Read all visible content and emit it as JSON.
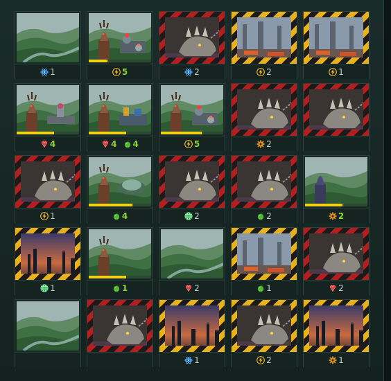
{
  "colors": {
    "hazard_red": "#b31f1f",
    "hazard_yellow": "#e8b21e",
    "value_highlight": "#8fd33a",
    "value_standard": "#c6d2cf"
  },
  "tiles": [
    {
      "art": "landscape",
      "border": "none",
      "progress": null,
      "resources": [
        {
          "icon": "atom-icon",
          "value": "1",
          "hi": false
        }
      ]
    },
    {
      "art": "alien-station",
      "border": "none",
      "progress": 0.3,
      "resources": [
        {
          "icon": "energy-icon",
          "value": "5",
          "hi": true
        }
      ]
    },
    {
      "art": "beast",
      "border": "red",
      "progress": null,
      "resources": [
        {
          "icon": "atom-icon",
          "value": "2",
          "hi": false
        }
      ]
    },
    {
      "art": "ruined-city",
      "border": "yellow",
      "progress": null,
      "resources": [
        {
          "icon": "energy-icon",
          "value": "2",
          "hi": false
        }
      ]
    },
    {
      "art": "ruined-city",
      "border": "yellow",
      "progress": null,
      "resources": [
        {
          "icon": "energy-icon",
          "value": "1",
          "hi": false
        }
      ]
    },
    {
      "art": "alien-lab",
      "border": "none",
      "progress": 0.6,
      "resources": [
        {
          "icon": "gem-icon",
          "value": "4",
          "hi": true
        }
      ]
    },
    {
      "art": "alien-factory",
      "border": "none",
      "progress": 0.6,
      "resources": [
        {
          "icon": "gem-icon",
          "value": "4",
          "hi": true
        },
        {
          "icon": "food-icon",
          "value": "4",
          "hi": true
        }
      ]
    },
    {
      "art": "alien-station",
      "border": "none",
      "progress": 0.65,
      "resources": [
        {
          "icon": "energy-icon",
          "value": "5",
          "hi": true
        }
      ]
    },
    {
      "art": "beast",
      "border": "red",
      "progress": null,
      "resources": [
        {
          "icon": "gear-icon",
          "value": "2",
          "hi": false
        }
      ]
    },
    {
      "art": "beast",
      "border": "red",
      "progress": null,
      "resources": []
    },
    {
      "art": "beast",
      "border": "red",
      "progress": null,
      "resources": [
        {
          "icon": "energy-icon",
          "value": "1",
          "hi": false
        }
      ]
    },
    {
      "art": "alien-dome",
      "border": "none",
      "progress": 0.7,
      "resources": [
        {
          "icon": "food-icon",
          "value": "4",
          "hi": true
        }
      ]
    },
    {
      "art": "beast",
      "border": "red",
      "progress": null,
      "resources": [
        {
          "icon": "globe-icon",
          "value": "2",
          "hi": false
        }
      ]
    },
    {
      "art": "beast",
      "border": "red",
      "progress": null,
      "resources": [
        {
          "icon": "food-icon",
          "value": "2",
          "hi": false
        }
      ]
    },
    {
      "art": "alien-lookout",
      "border": "none",
      "progress": 0.6,
      "resources": [
        {
          "icon": "gear-icon",
          "value": "2",
          "hi": true
        }
      ]
    },
    {
      "art": "sunset-city",
      "border": "yellow",
      "progress": null,
      "resources": [
        {
          "icon": "globe-icon",
          "value": "1",
          "hi": false
        }
      ]
    },
    {
      "art": "alien-valley",
      "border": "none",
      "progress": 0.6,
      "resources": [
        {
          "icon": "food-icon",
          "value": "1",
          "hi": true
        }
      ]
    },
    {
      "art": "landscape",
      "border": "none",
      "progress": null,
      "resources": [
        {
          "icon": "gem-icon",
          "value": "2",
          "hi": false
        }
      ]
    },
    {
      "art": "ruined-city",
      "border": "yellow",
      "progress": null,
      "resources": [
        {
          "icon": "food-icon",
          "value": "1",
          "hi": false
        }
      ]
    },
    {
      "art": "beast",
      "border": "red",
      "progress": null,
      "resources": [
        {
          "icon": "gem-icon",
          "value": "2",
          "hi": false
        }
      ]
    },
    {
      "art": "landscape",
      "border": "none",
      "progress": null,
      "resources": []
    },
    {
      "art": "beast",
      "border": "red",
      "progress": null,
      "resources": []
    },
    {
      "art": "sunset-city",
      "border": "yellow",
      "progress": null,
      "resources": [
        {
          "icon": "atom-icon",
          "value": "1",
          "hi": false
        }
      ]
    },
    {
      "art": "beast",
      "border": "yellow",
      "progress": null,
      "resources": [
        {
          "icon": "energy-icon",
          "value": "2",
          "hi": false
        }
      ]
    },
    {
      "art": "sunset-city",
      "border": "yellow",
      "progress": null,
      "resources": [
        {
          "icon": "gear-icon",
          "value": "1",
          "hi": false
        }
      ]
    }
  ]
}
